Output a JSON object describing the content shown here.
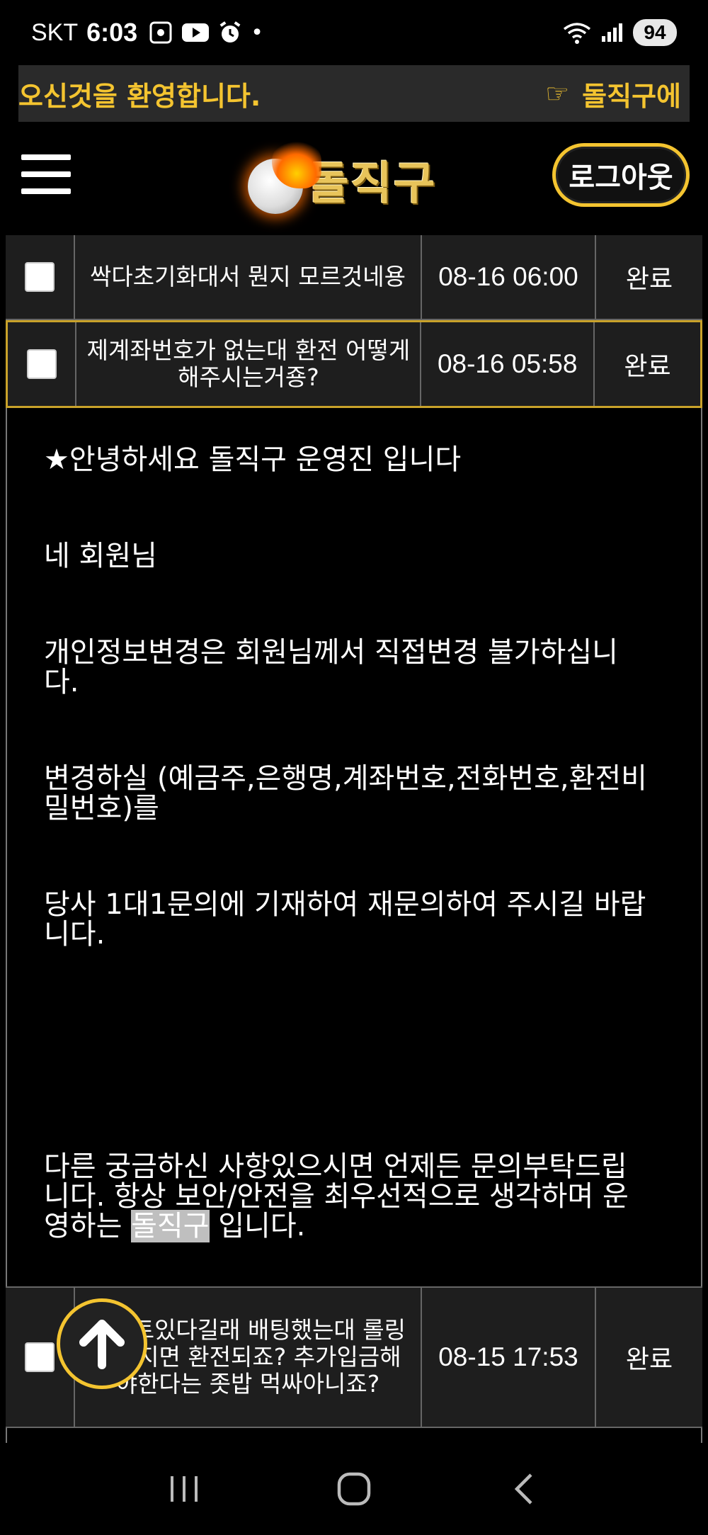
{
  "status_bar": {
    "carrier": "SKT",
    "time": "6:03",
    "dot": "•",
    "battery": "94",
    "icons": [
      "screenshot-icon",
      "youtube-icon",
      "alarm-icon",
      "wifi-icon",
      "signal-icon"
    ]
  },
  "marquee": {
    "left_text": "오신것을 환영합니다.",
    "right_text": "돌직구에",
    "hand_icon": "☞"
  },
  "header": {
    "logo_text": "돌직구",
    "logout_label": "로그아웃"
  },
  "inquiries": [
    {
      "title": "싹다초기화대서 뭔지 모르것네용",
      "date": "08-16 06:00",
      "status": "완료"
    },
    {
      "title": "제계좌번호가 없는대 환전 어떻게 해주시는거죵?",
      "date": "08-16 05:58",
      "status": "완료"
    },
    {
      "title": "이벤트있다길래 배팅했는대 롤링채워지면 환전되죠? 추가입금해야한다는 좃밥 먹싸아니죠?",
      "date": "08-15 17:53",
      "status": "완료"
    }
  ],
  "answer": {
    "line1": "★안녕하세요 돌직구 운영진 입니다",
    "line2": "네 회원님",
    "line3a": "개인정보변경은 회원님께서 직접변경 불가하십니",
    "line3b": "다.",
    "line4a": "변경하실 (예금주,은행명,계좌번호,전화번호,환전비",
    "line4b": "밀번호)를",
    "line5a": "당사 1대1문의에 기재하여 재문의하여 주시길 바랍",
    "line5b": "니다.",
    "line6a": "다른 궁금하신 사항있으시면 언제든 문의부탁드립",
    "line6b": "니다. 항상 보안/안전을 최우선적으로 생각하며 운",
    "line6c_pre": "영하는 ",
    "line6c_hl": "돌직구",
    "line6c_post": " 입니다."
  },
  "colors": {
    "accent": "#f4c430",
    "row_bg": "#1e1e1e",
    "highlight_border": "#c9a22a"
  }
}
